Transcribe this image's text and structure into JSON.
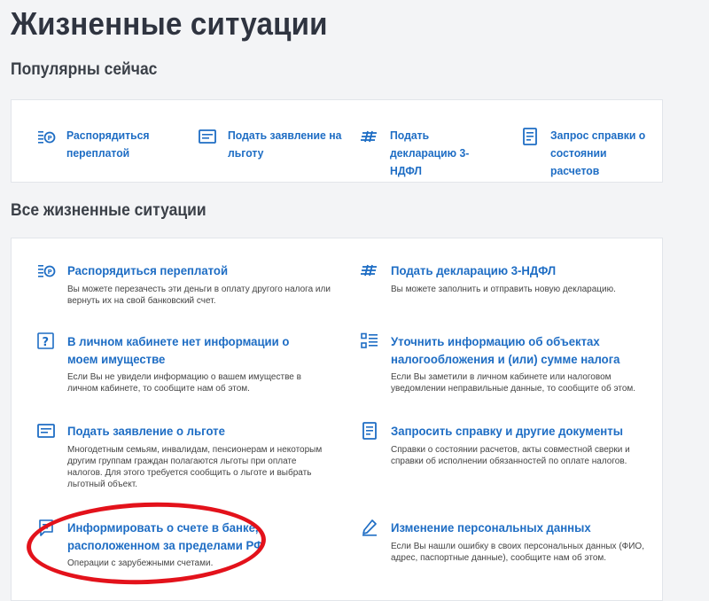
{
  "page": {
    "title": "Жизненные ситуации"
  },
  "popular": {
    "title": "Популярны сейчас",
    "items": [
      {
        "label": "Распорядиться переплатой",
        "icon": "overpayment-icon"
      },
      {
        "label": "Подать заявление на льготу",
        "icon": "application-icon"
      },
      {
        "label": "Подать декларацию 3-НДФЛ",
        "icon": "declaration-icon"
      },
      {
        "label": "Запрос справки о состоянии расчетов",
        "icon": "certificate-icon"
      }
    ]
  },
  "all": {
    "title": "Все жизненные ситуации",
    "items": [
      {
        "title": "Распорядиться переплатой",
        "desc": "Вы можете перезачесть эти деньги в оплату другого налога или вернуть их на свой банковский счет.",
        "icon": "overpayment-icon"
      },
      {
        "title": "Подать декларацию 3-НДФЛ",
        "desc": "Вы можете заполнить и отправить новую декларацию.",
        "icon": "declaration-icon"
      },
      {
        "title": "В личном кабинете нет информации о моем имуществе",
        "desc": "Если Вы не увидели информацию о вашем имуществе в личном кабинете, то сообщите нам об этом.",
        "icon": "question-icon"
      },
      {
        "title": "Уточнить информацию об объектах налогообложения и (или) сумме налога",
        "desc": "Если Вы заметили в личном кабинете или налоговом уведомлении неправильные данные, то сообщите об этом.",
        "icon": "list-icon"
      },
      {
        "title": "Подать заявление о льготе",
        "desc": "Многодетным семьям, инвалидам, пенсионерам и некоторым другим группам граждан полагаются льготы при оплате налогов. Для этого требуется сообщить о льготе и выбрать льготный объект.",
        "icon": "application-icon"
      },
      {
        "title": "Запросить справку и другие документы",
        "desc": "Справки о состоянии расчетов, акты совместной сверки и справки об исполнении обязанностей по оплате налогов.",
        "icon": "certificate-icon"
      },
      {
        "title": "Информировать о счете в банке, расположенном за пределами РФ",
        "desc": "Операции с зарубежными счетами.",
        "icon": "bank-account-icon"
      },
      {
        "title": "Изменение персональных данных",
        "desc": "Если Вы нашли ошибку в своих персональных данных (ФИО, адрес, паспортные данные), сообщите нам об этом.",
        "icon": "pencil-icon"
      }
    ]
  },
  "colors": {
    "link": "#1e6dc4",
    "highlight": "#e3121b",
    "background": "#f3f4f6"
  }
}
